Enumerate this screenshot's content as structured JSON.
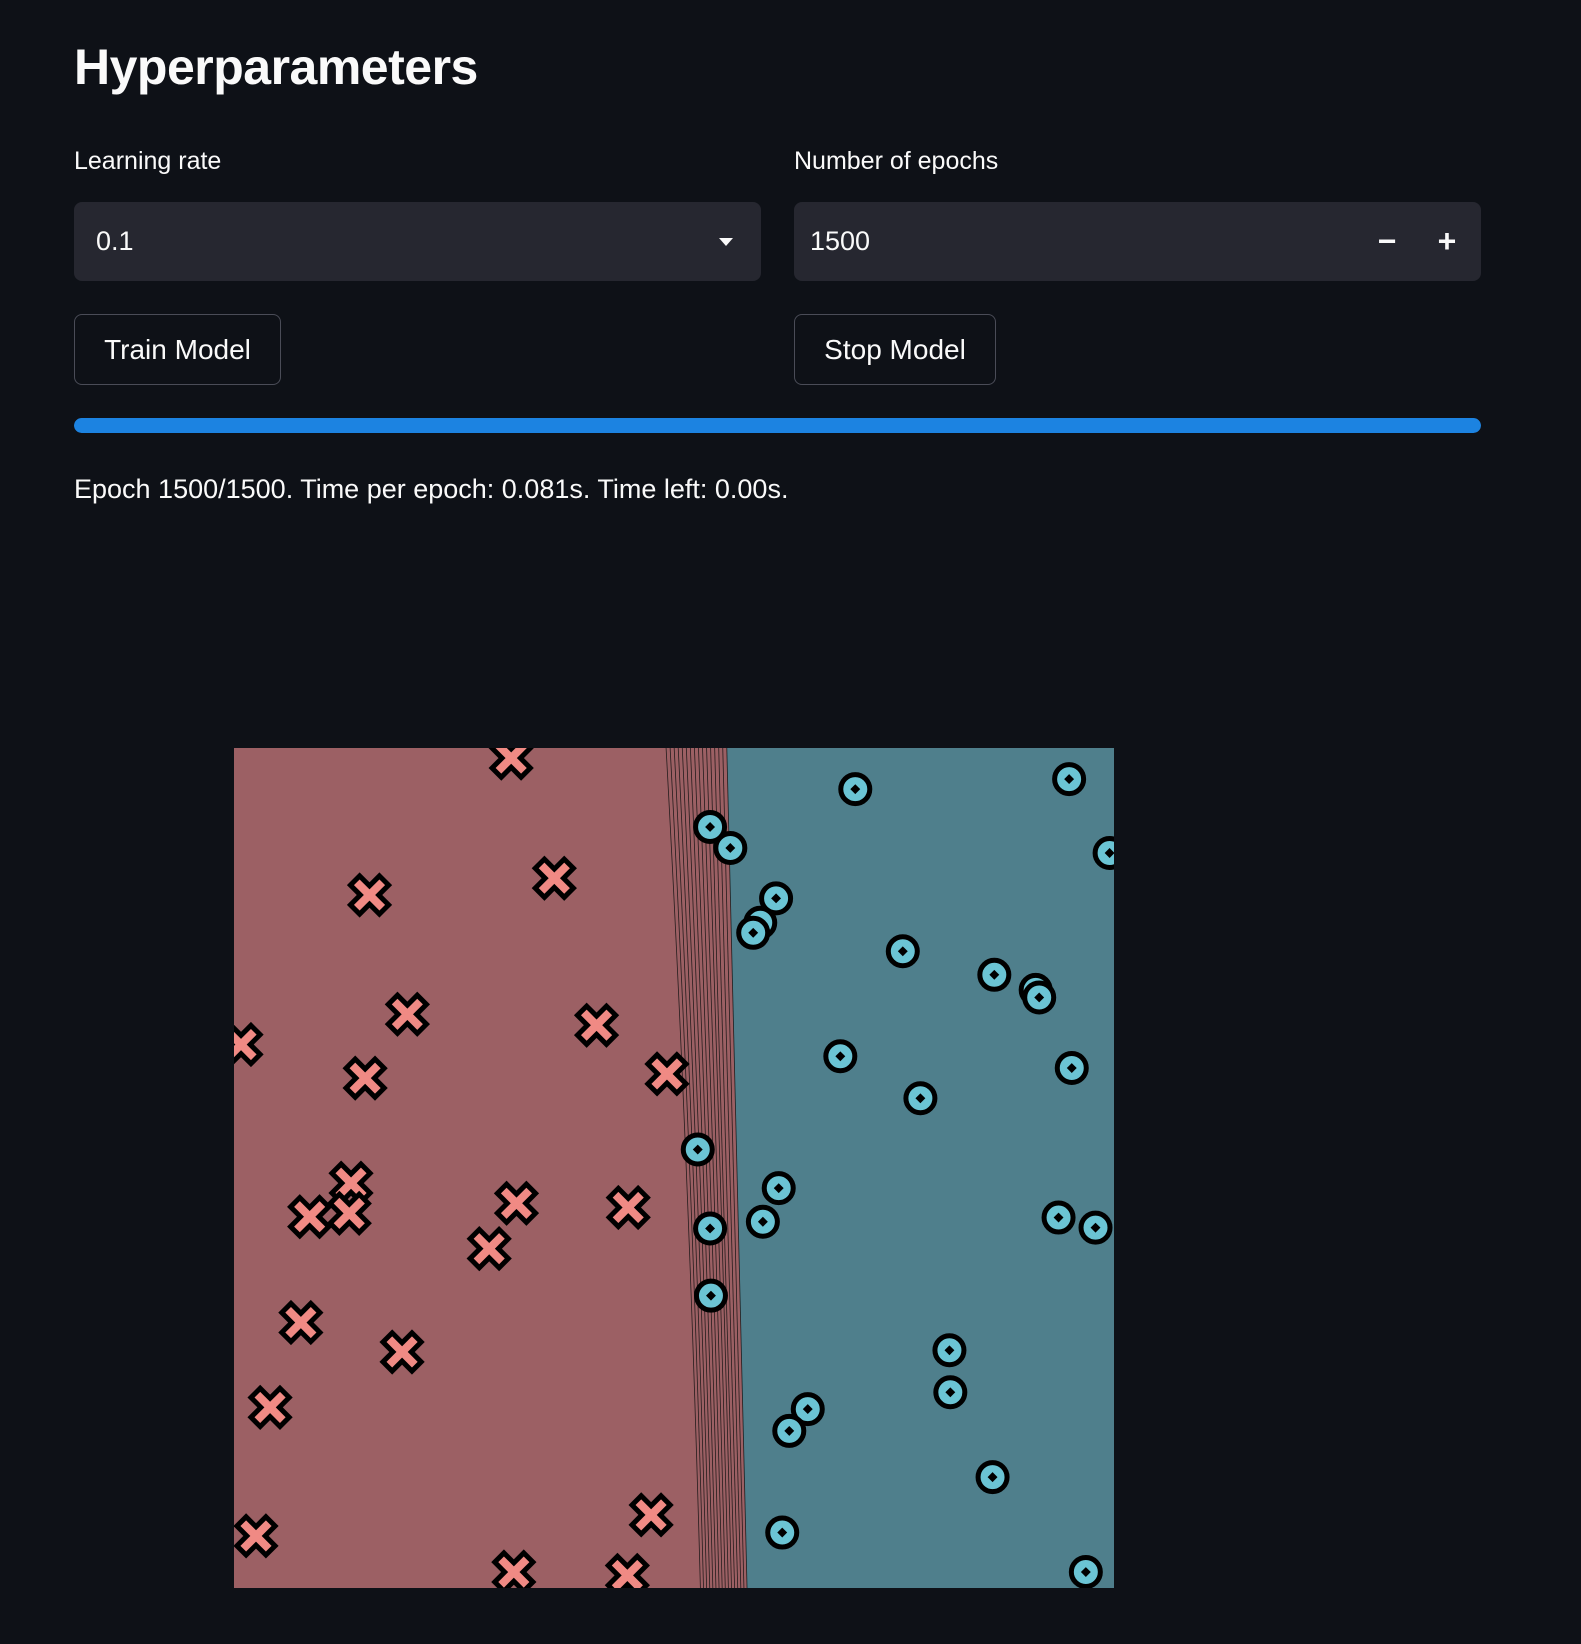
{
  "header": {
    "title": "Hyperparameters"
  },
  "learning_rate": {
    "label": "Learning rate",
    "value": "0.1",
    "icon": "chevron-down-icon"
  },
  "epochs": {
    "label": "Number of epochs",
    "value": "1500",
    "decrement": "−",
    "increment": "+"
  },
  "buttons": {
    "train": "Train Model",
    "stop": "Stop Model"
  },
  "progress": {
    "percent": 100,
    "color": "#1c83e1"
  },
  "status": "Epoch 1500/1500. Time per epoch: 0.081s. Time left: 0.00s.",
  "chart_data": {
    "type": "scatter",
    "title": "",
    "xlabel": "",
    "ylabel": "",
    "xlim": [
      0,
      10
    ],
    "ylim": [
      0,
      10
    ],
    "grid": false,
    "region_colors": {
      "class_0": "#9c6064",
      "class_1": "#4f7f8c"
    },
    "decision_boundary_lines": {
      "top_x": [
        4.91,
        5.6
      ],
      "bottom_x": [
        5.3,
        5.83
      ],
      "count": 16
    },
    "series": [
      {
        "marker": "x",
        "color": "#f08a84",
        "points": [
          [
            3.15,
            9.88
          ],
          [
            3.64,
            8.45
          ],
          [
            1.54,
            8.25
          ],
          [
            1.97,
            6.83
          ],
          [
            4.12,
            6.7
          ],
          [
            0.08,
            6.47
          ],
          [
            1.49,
            6.07
          ],
          [
            4.92,
            6.12
          ],
          [
            1.33,
            4.82
          ],
          [
            0.86,
            4.42
          ],
          [
            1.31,
            4.46
          ],
          [
            3.21,
            4.58
          ],
          [
            4.48,
            4.53
          ],
          [
            2.9,
            4.04
          ],
          [
            0.76,
            3.16
          ],
          [
            1.91,
            2.81
          ],
          [
            0.41,
            2.15
          ],
          [
            4.74,
            0.87
          ],
          [
            0.25,
            0.62
          ],
          [
            3.18,
            0.19
          ],
          [
            4.47,
            0.15
          ]
        ]
      },
      {
        "marker": "o",
        "color": "#6bc4d4",
        "points": [
          [
            7.06,
            9.51
          ],
          [
            9.49,
            9.63
          ],
          [
            5.41,
            9.06
          ],
          [
            5.64,
            8.81
          ],
          [
            9.95,
            8.75
          ],
          [
            6.16,
            8.21
          ],
          [
            5.98,
            7.92
          ],
          [
            5.9,
            7.8
          ],
          [
            7.6,
            7.58
          ],
          [
            8.64,
            7.3
          ],
          [
            9.11,
            7.12
          ],
          [
            9.15,
            7.03
          ],
          [
            6.89,
            6.33
          ],
          [
            9.52,
            6.19
          ],
          [
            7.8,
            5.83
          ],
          [
            5.27,
            5.22
          ],
          [
            6.19,
            4.76
          ],
          [
            5.41,
            4.28
          ],
          [
            6.01,
            4.36
          ],
          [
            9.37,
            4.41
          ],
          [
            9.79,
            4.29
          ],
          [
            5.42,
            3.48
          ],
          [
            8.13,
            2.83
          ],
          [
            8.14,
            2.33
          ],
          [
            6.52,
            2.13
          ],
          [
            6.31,
            1.87
          ],
          [
            8.62,
            1.32
          ],
          [
            6.23,
            0.66
          ],
          [
            9.68,
            0.19
          ]
        ]
      }
    ]
  }
}
